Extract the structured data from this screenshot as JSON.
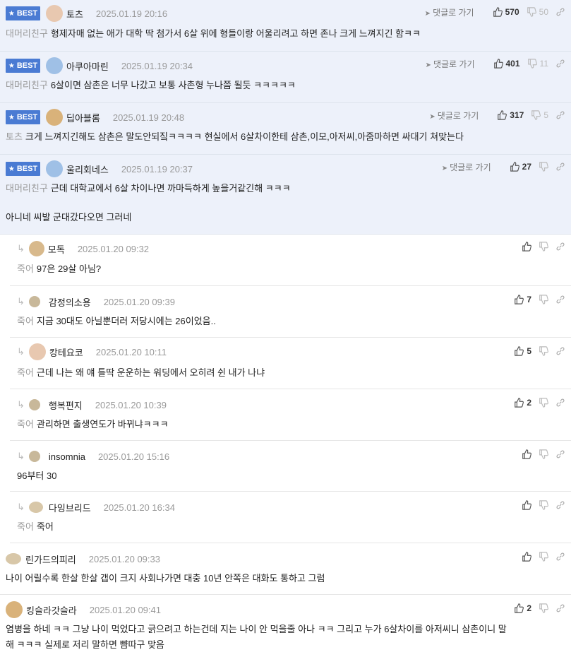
{
  "labels": {
    "best": "BEST",
    "reply_link": "댓글로 가기"
  },
  "comments": [
    {
      "nick": "토츠",
      "date": "2025.01.19 20:16",
      "tag": "대머리친구",
      "text": "형제자매 없는 애가 대학 딱 첨가서 6살 위에 형들이랑 어울리려고 하면 존나 크게 느껴지긴 함ㅋㅋ",
      "likes": "570",
      "dislikes": "50",
      "avatar_color": "#e8c8b0"
    },
    {
      "nick": "아쿠아마린",
      "date": "2025.01.19 20:34",
      "tag": "대머리친구",
      "text": "6살이면 삼촌은 너무 나갔고 보통 사촌형 누나쯤 될듯 ㅋㅋㅋㅋㅋ",
      "likes": "401",
      "dislikes": "11",
      "avatar_color": "#9fc0e6"
    },
    {
      "nick": "딥아블롬",
      "date": "2025.01.19 20:48",
      "tag": "토츠",
      "text": "크게 느껴지긴해도 삼촌은 말도안되짘ㅋㅋㅋㅋ 현실에서 6살차이한테 삼촌,이모,아저씨,아줌마하면 싸대기 쳐맞는다",
      "likes": "317",
      "dislikes": "5",
      "avatar_color": "#d9b27a"
    },
    {
      "nick": "울리회네스",
      "date": "2025.01.19 20:37",
      "tag": "대머리친구",
      "text": "근데 대학교에서 6살 차이나면 까마득하게 높을거같긴해 ㅋㅋㅋ",
      "text2": "아니네 씨발 군대갔다오면 그러네",
      "likes": "27",
      "dislikes": "",
      "avatar_color": "#9fc0e6"
    },
    {
      "nick": "모독",
      "date": "2025.01.20 09:32",
      "tag": "죽어",
      "text": "97은 29살 아님?",
      "likes": "",
      "avatar_color": "#d8b98c"
    },
    {
      "nick": "감정의소용",
      "date": "2025.01.20 09:39",
      "tag": "죽어",
      "text": "지금 30대도 아닐뿐더러 저당시에는 26이었음..",
      "likes": "7",
      "avatar_color": "#c8b89a"
    },
    {
      "nick": "캉테요코",
      "date": "2025.01.20 10:11",
      "tag": "죽어",
      "text": "근데 나는 왜 얘 틀딱 운운하는 워딩에서 오히려 쉰 내가 나냐",
      "likes": "5",
      "avatar_color": "#e8c8b0"
    },
    {
      "nick": "행복편지",
      "date": "2025.01.20 10:39",
      "tag": "죽어",
      "text": "관리하면 출생연도가 바뀌냐ㅋㅋㅋ",
      "likes": "2",
      "avatar_color": "#c8b89a"
    },
    {
      "nick": "insomnia",
      "date": "2025.01.20 15:16",
      "tag": "",
      "text": "96부터 30",
      "likes": "",
      "avatar_color": "#c8b89a"
    },
    {
      "nick": "다잉브리드",
      "date": "2025.01.20 16:34",
      "tag": "죽어",
      "text": "죽어",
      "likes": "",
      "avatar_color": "#d8c7a8"
    },
    {
      "nick": "린가드의피리",
      "date": "2025.01.20 09:33",
      "tag": "",
      "text": "나이 어릴수록 한살 한살 갭이 크지 사회나가면 대충 10년 안쪽은 대화도 통하고 그럼",
      "likes": "",
      "avatar_color": "#d8c7a8"
    },
    {
      "nick": "킹슬라갓슬라",
      "date": "2025.01.20 09:41",
      "tag": "",
      "text": "염병을 하네 ㅋㅋ 그냥 나이 먹었다고 긁으려고 하는건데 지는 나이 안 먹을줄 아나 ㅋㅋ 그리고 누가 6살차이를 아저씨니 삼촌이니 말",
      "text2": "해 ㅋㅋㅋ 실제로 저리 말하면 뺨따구 맞음",
      "likes": "2",
      "avatar_color": "#d9b27a"
    }
  ]
}
